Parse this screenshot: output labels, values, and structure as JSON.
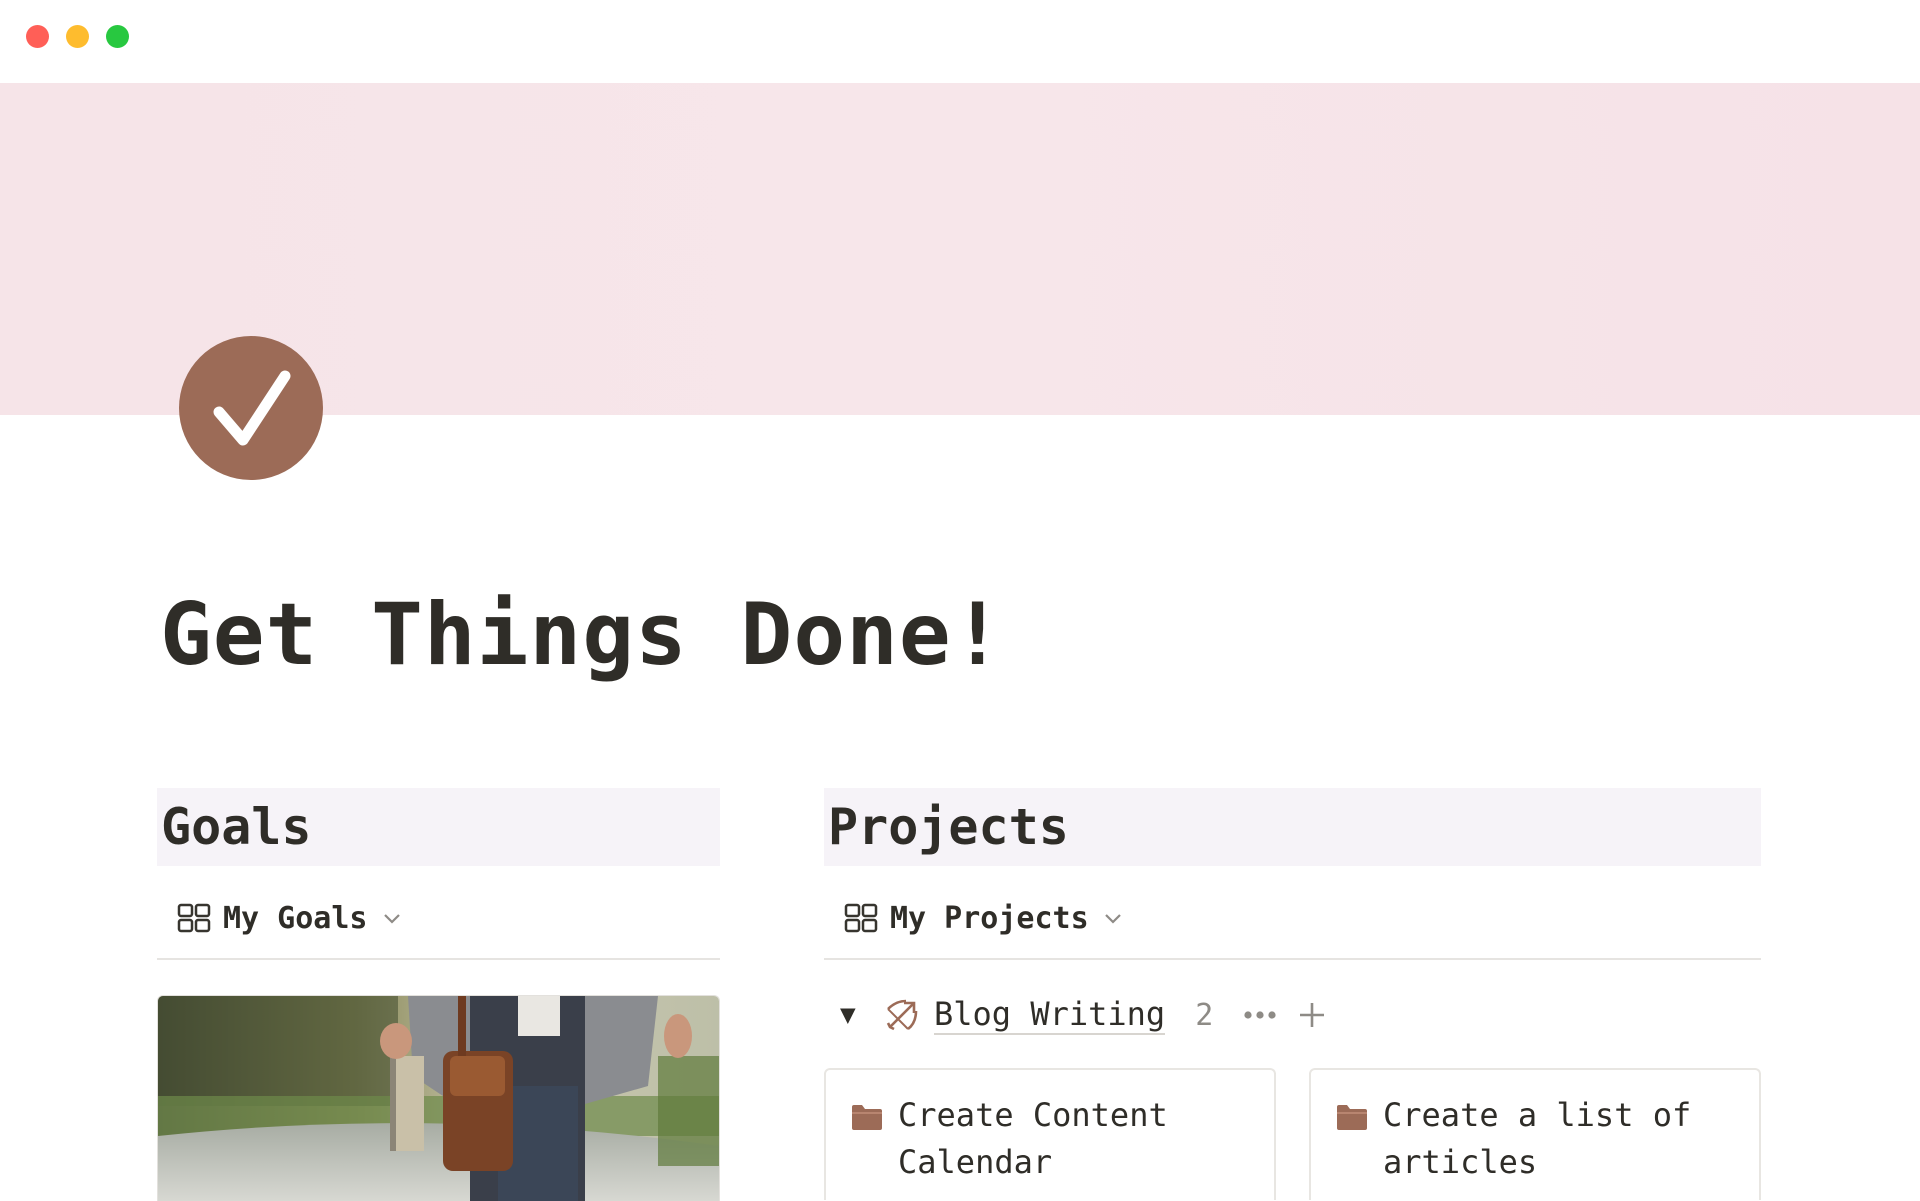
{
  "window": {
    "controls": [
      "close",
      "minimize",
      "zoom"
    ]
  },
  "page": {
    "icon": "check-circle-icon",
    "title": "Get Things Done!"
  },
  "goals": {
    "heading": "Goals",
    "view_label": "My Goals",
    "card_image": "person-holding-leather-bag-and-book-photo"
  },
  "projects": {
    "heading": "Projects",
    "view_label": "My Projects",
    "group": {
      "toggle": "▼",
      "icon": "bow-and-arrow-icon",
      "name": "Blog Writing",
      "count": "2"
    },
    "cards": [
      {
        "icon": "folder-icon",
        "title": "Create Content Calendar"
      },
      {
        "icon": "folder-icon",
        "title": "Create a list of articles"
      }
    ]
  },
  "colors": {
    "cover": "#f6e4e8",
    "icon_bg": "#9c6b57",
    "section_bg": "#f6f3f8",
    "text": "#2f2d28"
  }
}
